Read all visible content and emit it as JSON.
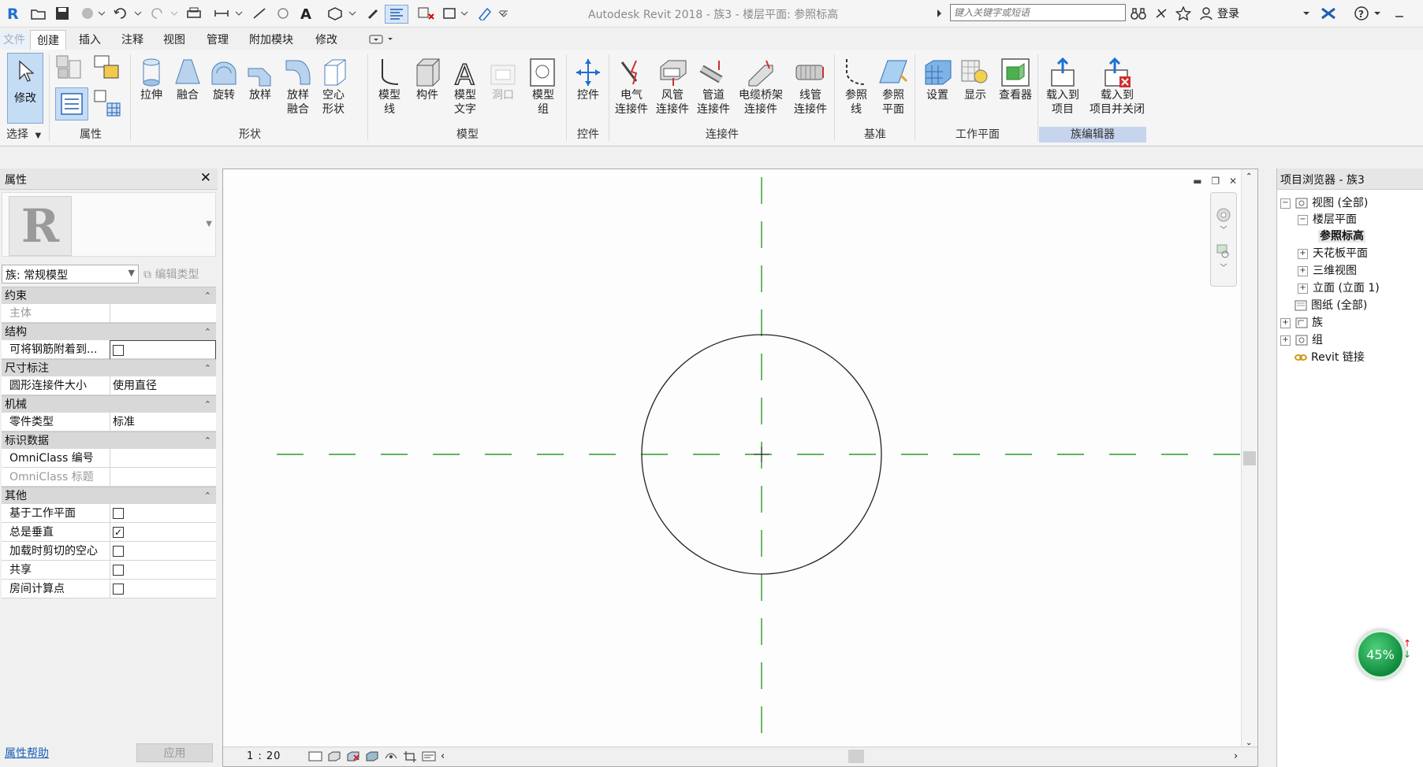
{
  "title_bar": {
    "app_title": "Autodesk Revit 2018 -    族3 - 楼层平面: 参照标高",
    "search_placeholder": "键入关键字或短语",
    "login_label": "登录"
  },
  "tabs": [
    {
      "label": "文件"
    },
    {
      "label": "创建"
    },
    {
      "label": "插入"
    },
    {
      "label": "注释"
    },
    {
      "label": "视图"
    },
    {
      "label": "管理"
    },
    {
      "label": "附加模块"
    },
    {
      "label": "修改"
    }
  ],
  "ribbon": {
    "modify_label": "修改",
    "select_label": "选择",
    "groups": {
      "properties": "属性",
      "forms": "形状",
      "model": "模型",
      "control": "控件",
      "connectors": "连接件",
      "datum": "基准",
      "workplane": "工作平面",
      "family_editor": "族编辑器"
    },
    "buttons": {
      "extrusion": "拉伸",
      "blend": "融合",
      "revolve": "旋转",
      "sweep": "放样",
      "swept_blend_1": "放样",
      "swept_blend_2": "融合",
      "void_1": "空心",
      "void_2": "形状",
      "model_line_1": "模型",
      "model_line_2": "线",
      "component": "构件",
      "model_text_1": "模型",
      "model_text_2": "文字",
      "opening": "洞口",
      "model_group_1": "模型",
      "model_group_2": "组",
      "control": "控件",
      "elec_1": "电气",
      "elec_2": "连接件",
      "duct_1": "风管",
      "duct_2": "连接件",
      "pipe_1": "管道",
      "pipe_2": "连接件",
      "tray_1": "电缆桥架",
      "tray_2": "连接件",
      "conduit_1": "线管",
      "conduit_2": "连接件",
      "ref_line_1": "参照",
      "ref_line_2": "线",
      "ref_plane_1": "参照",
      "ref_plane_2": "平面",
      "set": "设置",
      "show": "显示",
      "viewer": "查看器",
      "load_1": "载入到",
      "load_2": "项目",
      "load_close_1": "载入到",
      "load_close_2": "项目并关闭"
    }
  },
  "properties": {
    "title": "属性",
    "family_type": "族: 常规模型",
    "edit_type": "编辑类型",
    "sections": [
      {
        "name": "约束",
        "rows": [
          {
            "key": "主体",
            "value": "",
            "grey": true
          }
        ]
      },
      {
        "name": "结构",
        "rows": [
          {
            "key": "可将钢筋附着到...",
            "checkbox": false
          }
        ]
      },
      {
        "name": "尺寸标注",
        "rows": [
          {
            "key": "圆形连接件大小",
            "value": "使用直径"
          }
        ]
      },
      {
        "name": "机械",
        "rows": [
          {
            "key": "零件类型",
            "value": "标准"
          }
        ]
      },
      {
        "name": "标识数据",
        "rows": [
          {
            "key": "OmniClass 编号",
            "value": ""
          },
          {
            "key": "OmniClass 标题",
            "value": "",
            "grey": true
          }
        ]
      },
      {
        "name": "其他",
        "rows": [
          {
            "key": "基于工作平面",
            "checkbox": false
          },
          {
            "key": "总是垂直",
            "checkbox": true
          },
          {
            "key": "加载时剪切的空心",
            "checkbox": false
          },
          {
            "key": "共享",
            "checkbox": false
          },
          {
            "key": "房间计算点",
            "checkbox": false
          }
        ]
      }
    ],
    "help_link": "属性帮助",
    "apply_label": "应用"
  },
  "view": {
    "scale": "1 : 20"
  },
  "browser": {
    "title": "项目浏览器 - 族3",
    "nodes": {
      "views": "视图 (全部)",
      "floor_plans": "楼层平面",
      "ref_level": "参照标高",
      "ceiling_plans": "天花板平面",
      "3d_views": "三维视图",
      "elevations": "立面 (立面 1)",
      "sheets": "图纸 (全部)",
      "families": "族",
      "groups": "组",
      "revit_links": "Revit 链接"
    }
  },
  "progress": {
    "percent": 45,
    "label": "45%"
  },
  "colors": {
    "accent": "#1a5fb4",
    "ref_plane": "#2a9d2a",
    "progress": "#0f8a3c"
  }
}
